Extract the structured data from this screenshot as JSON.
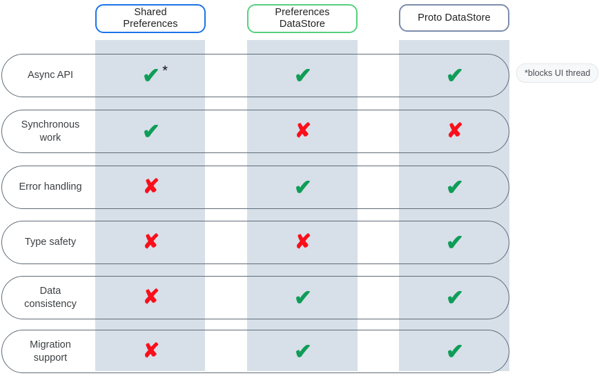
{
  "headers": [
    {
      "label": "Shared Preferences",
      "line1": "Shared",
      "line2": "Preferences",
      "border_color": "#1a73e8"
    },
    {
      "label": "Preferences DataStore",
      "line1": "Preferences",
      "line2": "DataStore",
      "border_color": "#54d07e"
    },
    {
      "label": "Proto DataStore",
      "line1": "Proto DataStore",
      "line2": "",
      "border_color": "#7b8bab"
    }
  ],
  "rows": [
    {
      "label": "Async API",
      "line1": "Async API",
      "line2": "",
      "cells": [
        {
          "value": "check",
          "glyph": "✔",
          "footnote_marker": "*"
        },
        {
          "value": "check",
          "glyph": "✔",
          "footnote_marker": ""
        },
        {
          "value": "check",
          "glyph": "✔",
          "footnote_marker": ""
        }
      ]
    },
    {
      "label": "Synchronous work",
      "line1": "Synchronous",
      "line2": "work",
      "cells": [
        {
          "value": "check",
          "glyph": "✔",
          "footnote_marker": ""
        },
        {
          "value": "cross",
          "glyph": "✘",
          "footnote_marker": ""
        },
        {
          "value": "cross",
          "glyph": "✘",
          "footnote_marker": ""
        }
      ]
    },
    {
      "label": "Error handling",
      "line1": "Error handling",
      "line2": "",
      "cells": [
        {
          "value": "cross",
          "glyph": "✘",
          "footnote_marker": ""
        },
        {
          "value": "check",
          "glyph": "✔",
          "footnote_marker": ""
        },
        {
          "value": "check",
          "glyph": "✔",
          "footnote_marker": ""
        }
      ]
    },
    {
      "label": "Type safety",
      "line1": "Type safety",
      "line2": "",
      "cells": [
        {
          "value": "cross",
          "glyph": "✘",
          "footnote_marker": ""
        },
        {
          "value": "cross",
          "glyph": "✘",
          "footnote_marker": ""
        },
        {
          "value": "check",
          "glyph": "✔",
          "footnote_marker": ""
        }
      ]
    },
    {
      "label": "Data consistency",
      "line1": "Data",
      "line2": "consistency",
      "cells": [
        {
          "value": "cross",
          "glyph": "✘",
          "footnote_marker": ""
        },
        {
          "value": "check",
          "glyph": "✔",
          "footnote_marker": ""
        },
        {
          "value": "check",
          "glyph": "✔",
          "footnote_marker": ""
        }
      ]
    },
    {
      "label": "Migration support",
      "line1": "Migration",
      "line2": "support",
      "cells": [
        {
          "value": "cross",
          "glyph": "✘",
          "footnote_marker": ""
        },
        {
          "value": "check",
          "glyph": "✔",
          "footnote_marker": ""
        },
        {
          "value": "check",
          "glyph": "✔",
          "footnote_marker": ""
        }
      ]
    }
  ],
  "footnote": {
    "text": "*blocks UI thread"
  },
  "colors": {
    "check_green": "#0f9d58",
    "cross_red": "#fa0f1a",
    "band_shade": "#d7dfe8",
    "row_border": "#5f6b76",
    "label_text": "#3c4043"
  }
}
